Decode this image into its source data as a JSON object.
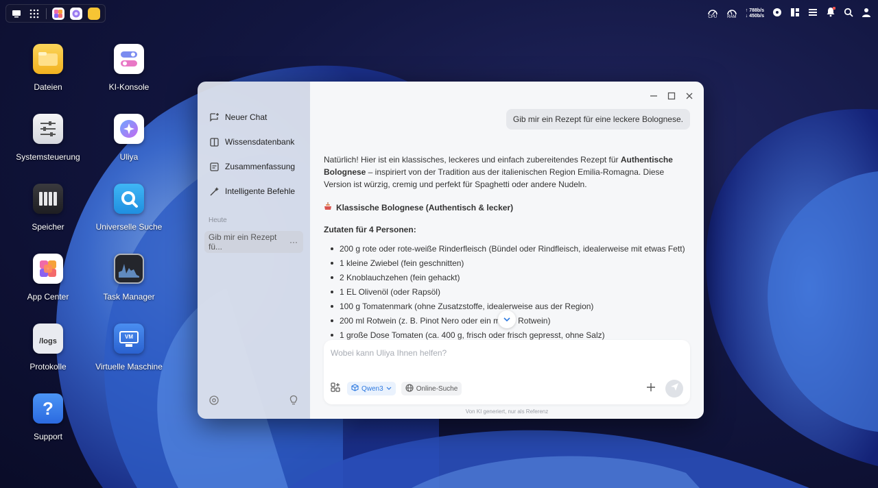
{
  "taskbar": {
    "cpu_label": "CPU",
    "ram_label": "RAM",
    "net_up": "↑ 788b/s",
    "net_down": "↓ 450b/s"
  },
  "desktop": {
    "icons": [
      {
        "label": "Dateien",
        "icon": "folder-icon"
      },
      {
        "label": "KI-Konsole",
        "icon": "toggle-console-icon"
      },
      {
        "label": "Systemsteuerung",
        "icon": "sliders-icon"
      },
      {
        "label": "Uliya",
        "icon": "ai-star-icon"
      },
      {
        "label": "Speicher",
        "icon": "storage-icon"
      },
      {
        "label": "Universelle Suche",
        "icon": "search-icon"
      },
      {
        "label": "App Center",
        "icon": "app-center-icon"
      },
      {
        "label": "Task Manager",
        "icon": "activity-chart-icon"
      },
      {
        "label": "Protokolle",
        "icon": "logs-icon",
        "icon_text": "/logs"
      },
      {
        "label": "Virtuelle Maschine",
        "icon": "vm-monitor-icon",
        "icon_text": "VM"
      },
      {
        "label": "Support",
        "icon": "question-icon"
      }
    ]
  },
  "chat_window": {
    "sidebar": {
      "items": [
        {
          "label": "Neuer Chat",
          "icon": "new-chat-icon"
        },
        {
          "label": "Wissensdatenbank",
          "icon": "book-icon"
        },
        {
          "label": "Zusammenfassung",
          "icon": "summary-icon"
        },
        {
          "label": "Intelligente Befehle",
          "icon": "magic-wand-icon"
        }
      ],
      "section_today": "Heute",
      "history": [
        {
          "label": "Gib mir ein Rezept fü...",
          "more": "···"
        }
      ]
    },
    "user_message": "Gib mir ein Rezept für eine leckere Bolognese.",
    "answer": {
      "intro_1": "Natürlich! Hier ist ein klassisches, leckeres und einfach zubereitendes Rezept für ",
      "intro_bold": "Authentische Bolognese",
      "intro_2": " – inspiriert von der Tradition aus der italienischen Region Emilia-Romagna. Diese Version ist würzig, cremig und perfekt für Spaghetti oder andere Nudeln.",
      "heading": "Klassische Bolognese (Authentisch & lecker)",
      "ingredients_title": "Zutaten für 4 Personen:",
      "ingredients": [
        "200 g rote oder rote-weiße Rinderfleisch (Bündel oder Rindfleisch, idealerweise mit etwas Fett)",
        "1 kleine Zwiebel (fein geschnitten)",
        "2 Knoblauchzehen (fein gehackt)",
        "1 EL Olivenöl (oder Rapsöl)",
        "100 g Tomatenmark (ohne Zusatzstoffe, idealerweise aus der Region)",
        "200 ml Rotwein (z. B. Pinot Nero oder ein milder Rotwein)",
        "1 große Dose Tomaten (ca. 400 g, frisch oder frisch gepresst, ohne Salz)"
      ]
    },
    "composer": {
      "placeholder": "Wobei kann Uliya Ihnen helfen?",
      "model_label": "Qwen3",
      "web_search_label": "Online-Suche"
    },
    "disclaimer": "Von KI generiert, nur als Referenz"
  },
  "colors": {
    "accent": "#2f7ae0",
    "sidebar_bg": "#dee2ec",
    "main_bg": "#f6f7f9"
  }
}
